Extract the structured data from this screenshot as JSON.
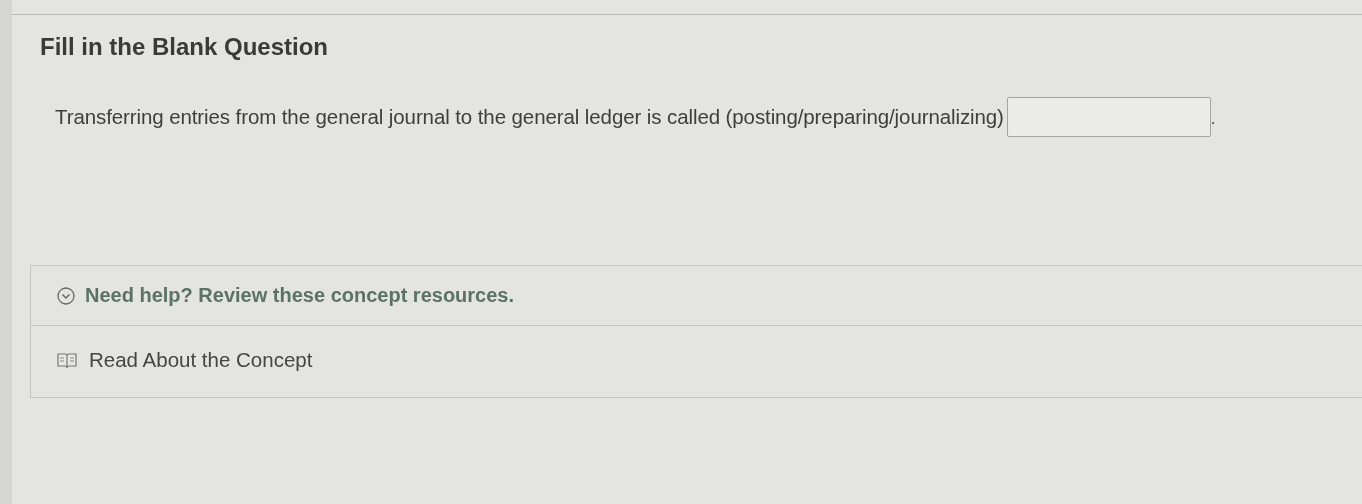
{
  "title": "Fill in the Blank Question",
  "question": {
    "prompt": "Transferring entries from the general journal to the general ledger is called (posting/preparing/journalizing)",
    "suffix": "."
  },
  "help": {
    "label": "Need help? Review these concept resources.",
    "expanded": true,
    "resources": [
      {
        "label": "Read About the Concept"
      }
    ]
  }
}
